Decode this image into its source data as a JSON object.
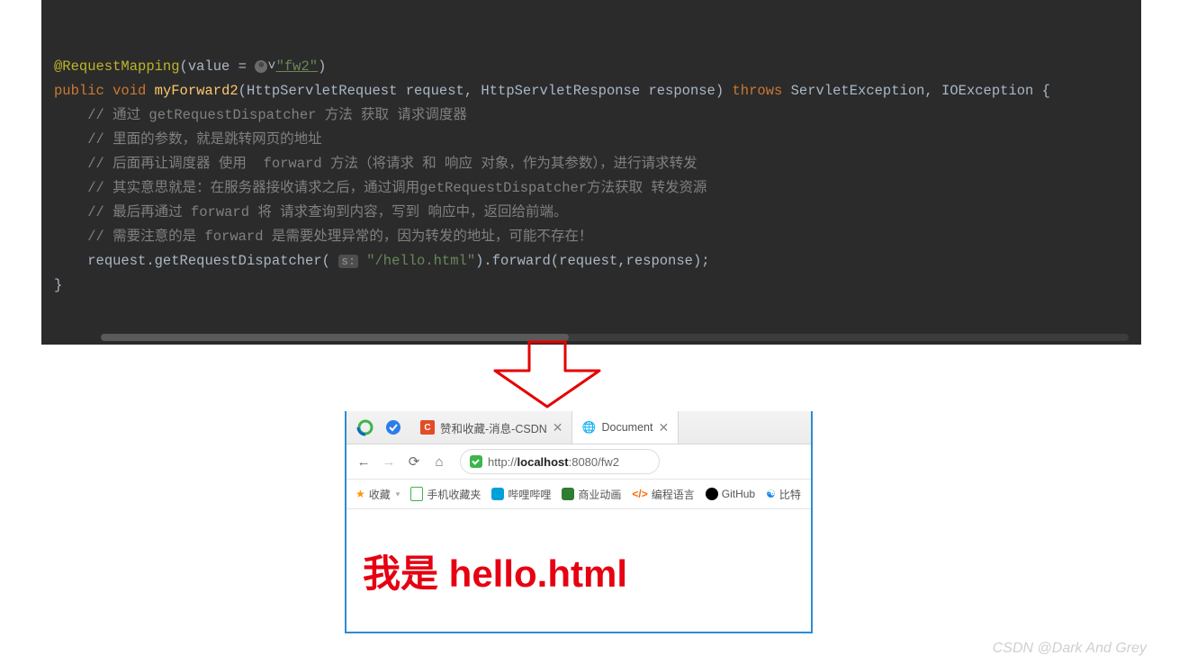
{
  "code": {
    "annotation": "@RequestMapping",
    "annotation_args": "(value = ",
    "mapping_value": "\"fw2\"",
    "annotation_close": ")",
    "sig_public": "public",
    "sig_void": "void",
    "sig_method": "myForward2",
    "sig_args": "(HttpServletRequest request, HttpServletResponse response)",
    "sig_throws": "throws",
    "sig_exc": "ServletException, IOException {",
    "comment1": "// 通过 getRequestDispatcher 方法 获取 请求调度器",
    "comment2": "// 里面的参数，就是跳转网页的地址",
    "comment3": "// 后面再让调度器 使用  forward 方法（将请求 和 响应 对象，作为其参数），进行请求转发",
    "comment4": "// 其实意思就是：在服务器接收请求之后，通过调用getRequestDispatcher方法获取 转发资源",
    "comment5": "// 最后再通过 forward 将 请求查询到内容，写到 响应中，返回给前端。",
    "comment6": "// 需要注意的是 forward 是需要处理异常的，因为转发的地址，可能不存在！",
    "dispatch_obj": "request.getRequestDispatcher(",
    "dispatch_hint": "s:",
    "dispatch_path": "\"/hello.html\"",
    "dispatch_call": ").forward(request,response);",
    "close_brace": "}"
  },
  "browser": {
    "tabs": {
      "inactive_title": "赞和收藏-消息-CSDN",
      "active_title": "Document"
    },
    "url_prefix": "http://",
    "url_host": "localhost",
    "url_rest": ":8080/fw2",
    "bookmarks": {
      "fav": "收藏",
      "mobile": "手机收藏夹",
      "bilibili": "哔哩哔哩",
      "anime": "商业动画",
      "coding": "编程语言",
      "github": "GitHub",
      "compare": "比特"
    },
    "page_text": "我是 hello.html"
  },
  "watermark": "CSDN @Dark And Grey"
}
